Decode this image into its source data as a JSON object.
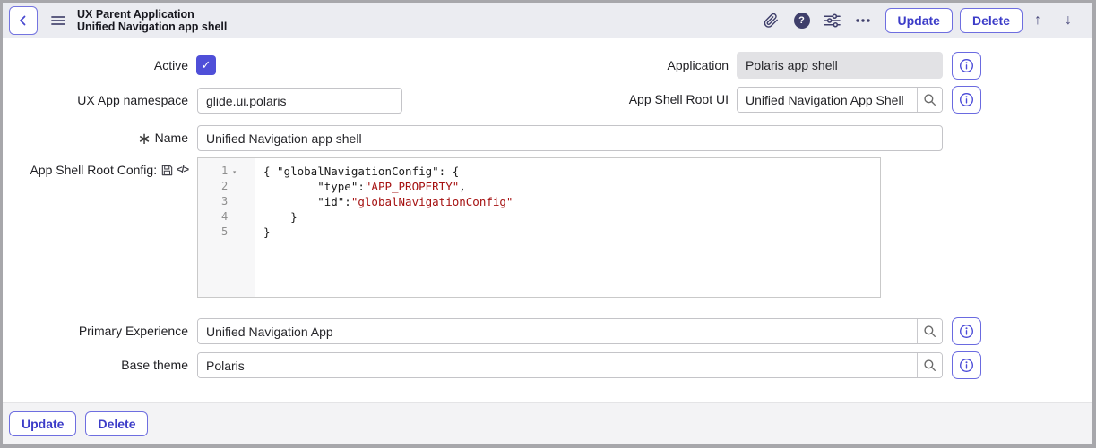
{
  "header": {
    "title_line1": "UX Parent Application",
    "title_line2": "Unified Navigation app shell",
    "buttons": {
      "update": "Update",
      "delete": "Delete"
    },
    "icons": {
      "more": "•••",
      "up_arrow": "↑",
      "down_arrow": "↓",
      "help": "?"
    }
  },
  "form": {
    "active": {
      "label": "Active",
      "checked": true,
      "check_glyph": "✓"
    },
    "application": {
      "label": "Application",
      "value": "Polaris app shell"
    },
    "ux_app_namespace": {
      "label": "UX App namespace",
      "value": "glide.ui.polaris"
    },
    "app_shell_root_ui": {
      "label": "App Shell Root UI",
      "value": "Unified Navigation App Shell"
    },
    "name": {
      "required_marker": "∗",
      "label": "Name",
      "value": "Unified Navigation app shell"
    },
    "app_shell_root_config": {
      "label": "App Shell Root Config:",
      "code_icon_glyph": "</>",
      "fold_marker": "▾",
      "lines": [
        [
          {
            "text": "{ \"globalNavigationConfig\": {",
            "type": "plain"
          }
        ],
        [
          {
            "text": "        \"type\":",
            "type": "plain"
          },
          {
            "text": "\"APP_PROPERTY\"",
            "type": "string"
          },
          {
            "text": ",",
            "type": "plain"
          }
        ],
        [
          {
            "text": "        \"id\":",
            "type": "plain"
          },
          {
            "text": "\"globalNavigationConfig\"",
            "type": "string"
          }
        ],
        [
          {
            "text": "    }",
            "type": "plain"
          }
        ],
        [
          {
            "text": "}",
            "type": "plain"
          }
        ]
      ]
    },
    "primary_experience": {
      "label": "Primary Experience",
      "value": "Unified Navigation App"
    },
    "base_theme": {
      "label": "Base theme",
      "value": "Polaris"
    }
  },
  "footer": {
    "update": "Update",
    "delete": "Delete"
  },
  "colors": {
    "accent": "#4545d0",
    "header_bg": "#ebecf1",
    "header_icon": "#3f3f6b",
    "checkbox": "#4f4fd8",
    "code_string": "#a51111",
    "readonly_bg": "#e2e2e5"
  }
}
